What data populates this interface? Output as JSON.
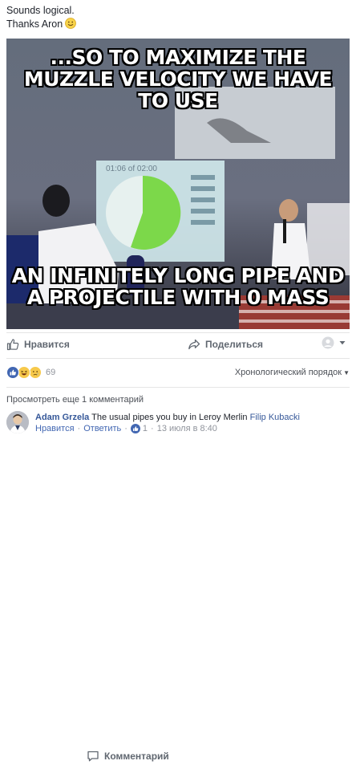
{
  "post": {
    "text_line1": "Sounds logical.",
    "text_line2": "Thanks Aron"
  },
  "meme": {
    "top_caption": "...SO TO MAXIMIZE THE MUZZLE VELOCITY WE HAVE TO USE",
    "bottom_caption": "AN INFINITELY LONG PIPE AND A PROJECTILE WITH 0 MASS",
    "timer_text": "01:06 of 02:00",
    "timer_progress": 0.55
  },
  "actions": {
    "like": "Нравится",
    "comment": "Комментарий",
    "share": "Поделиться"
  },
  "reactions": {
    "count": "69",
    "sort_label": "Хронологический порядок"
  },
  "comments": {
    "more_label": "Просмотреть еще 1 комментарий",
    "items": [
      {
        "author": "Adam Grzela",
        "text": "The usual pipes you buy in Leroy Merlin",
        "mention": "Filip Kubacki",
        "like_label": "Нравится",
        "reply_label": "Ответить",
        "likes": "1",
        "timestamp": "13 июля в 8:40"
      }
    ]
  },
  "colors": {
    "facebook_blue": "#4267b2",
    "link_blue": "#365899",
    "muted_gray": "#90949c",
    "action_gray": "#606770"
  }
}
